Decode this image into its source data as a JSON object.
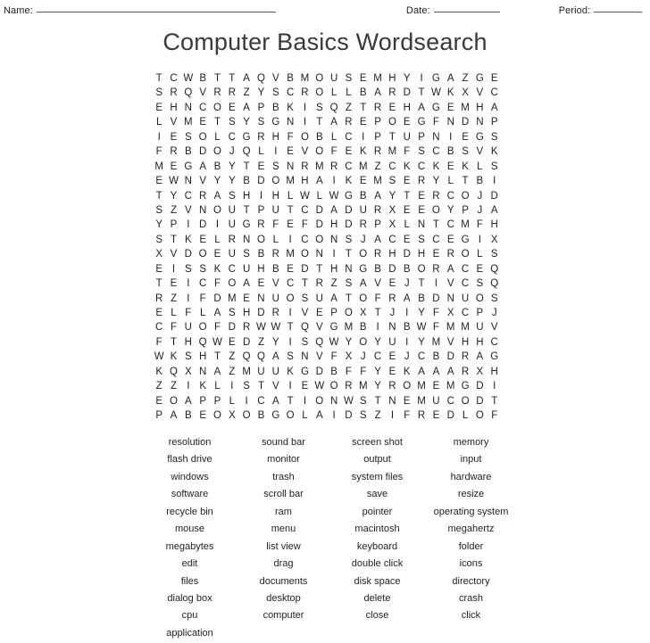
{
  "header": {
    "name_label": "Name:",
    "date_label": "Date:",
    "period_label": "Period:"
  },
  "title": "Computer Basics Wordsearch",
  "grid": {
    "rows": 24,
    "cols": 23,
    "letters": [
      [
        "T",
        "C",
        "W",
        "B",
        "T",
        "T",
        "A",
        "Q",
        "V",
        "B",
        "M",
        "O",
        "U",
        "S",
        "E",
        "M",
        "H",
        "Y",
        "I",
        "G",
        "A",
        "Z",
        "G",
        "E"
      ],
      [
        "S",
        "R",
        "Q",
        "V",
        "R",
        "R",
        "Z",
        "Y",
        "S",
        "C",
        "R",
        "O",
        "L",
        "L",
        "B",
        "A",
        "R",
        "D",
        "T",
        "W",
        "K",
        "X",
        "V",
        "C"
      ],
      [
        "E",
        "H",
        "N",
        "C",
        "O",
        "E",
        "A",
        "P",
        "B",
        "K",
        "I",
        "S",
        "Q",
        "Z",
        "T",
        "R",
        "E",
        "H",
        "A",
        "G",
        "E",
        "M",
        "H",
        "A"
      ],
      [
        "L",
        "V",
        "M",
        "E",
        "T",
        "S",
        "Y",
        "S",
        "G",
        "N",
        "I",
        "T",
        "A",
        "R",
        "E",
        "P",
        "O",
        "E",
        "G",
        "F",
        "N",
        "D",
        "N",
        "P"
      ],
      [
        "I",
        "E",
        "S",
        "O",
        "L",
        "C",
        "G",
        "R",
        "H",
        "F",
        "O",
        "B",
        "L",
        "C",
        "I",
        "P",
        "T",
        "U",
        "P",
        "N",
        "I",
        "E",
        "G",
        "S"
      ],
      [
        "F",
        "R",
        "B",
        "D",
        "O",
        "J",
        "Q",
        "L",
        "I",
        "E",
        "V",
        "O",
        "F",
        "E",
        "K",
        "R",
        "M",
        "F",
        "S",
        "C",
        "B",
        "S",
        "V",
        "K"
      ],
      [
        "M",
        "E",
        "G",
        "A",
        "B",
        "Y",
        "T",
        "E",
        "S",
        "N",
        "R",
        "M",
        "R",
        "C",
        "M",
        "Z",
        "C",
        "K",
        "C",
        "K",
        "E",
        "K",
        "L",
        "S"
      ],
      [
        "E",
        "W",
        "N",
        "V",
        "Y",
        "Y",
        "B",
        "D",
        "O",
        "M",
        "H",
        "A",
        "I",
        "K",
        "E",
        "M",
        "S",
        "E",
        "R",
        "Y",
        "L",
        "T",
        "B",
        "I"
      ],
      [
        "T",
        "Y",
        "C",
        "R",
        "A",
        "S",
        "H",
        "I",
        "H",
        "L",
        "W",
        "L",
        "W",
        "G",
        "B",
        "A",
        "Y",
        "T",
        "E",
        "R",
        "C",
        "O",
        "J",
        "D"
      ],
      [
        "S",
        "Z",
        "V",
        "N",
        "O",
        "U",
        "T",
        "P",
        "U",
        "T",
        "C",
        "D",
        "A",
        "D",
        "U",
        "R",
        "X",
        "E",
        "E",
        "O",
        "Y",
        "P",
        "J",
        "A"
      ],
      [
        "Y",
        "P",
        "I",
        "D",
        "I",
        "U",
        "G",
        "R",
        "F",
        "E",
        "F",
        "D",
        "H",
        "D",
        "R",
        "P",
        "X",
        "L",
        "N",
        "T",
        "C",
        "M",
        "F",
        "H"
      ],
      [
        "S",
        "T",
        "K",
        "E",
        "L",
        "R",
        "N",
        "O",
        "L",
        "I",
        "C",
        "O",
        "N",
        "S",
        "J",
        "A",
        "C",
        "E",
        "S",
        "C",
        "E",
        "G",
        "I",
        "X"
      ],
      [
        "X",
        "V",
        "D",
        "O",
        "E",
        "U",
        "S",
        "B",
        "R",
        "M",
        "O",
        "N",
        "I",
        "T",
        "O",
        "R",
        "H",
        "D",
        "H",
        "E",
        "R",
        "O",
        "L",
        "S"
      ],
      [
        "E",
        "I",
        "S",
        "S",
        "K",
        "C",
        "U",
        "H",
        "B",
        "E",
        "D",
        "T",
        "H",
        "N",
        "G",
        "B",
        "D",
        "B",
        "O",
        "R",
        "A",
        "C",
        "E",
        "Q"
      ],
      [
        "T",
        "E",
        "I",
        "C",
        "F",
        "O",
        "A",
        "E",
        "V",
        "C",
        "T",
        "R",
        "Z",
        "S",
        "A",
        "V",
        "E",
        "J",
        "T",
        "I",
        "V",
        "C",
        "S",
        "Q"
      ],
      [
        "R",
        "Z",
        "I",
        "F",
        "D",
        "M",
        "E",
        "N",
        "U",
        "O",
        "S",
        "U",
        "A",
        "T",
        "O",
        "F",
        "R",
        "A",
        "B",
        "D",
        "N",
        "U",
        "O",
        "S"
      ],
      [
        "E",
        "L",
        "F",
        "L",
        "A",
        "S",
        "H",
        "D",
        "R",
        "I",
        "V",
        "E",
        "P",
        "O",
        "X",
        "T",
        "J",
        "I",
        "Y",
        "F",
        "X",
        "C",
        "P",
        "J"
      ],
      [
        "C",
        "F",
        "U",
        "O",
        "F",
        "D",
        "R",
        "W",
        "W",
        "T",
        "Q",
        "V",
        "G",
        "M",
        "B",
        "I",
        "N",
        "B",
        "W",
        "F",
        "M",
        "M",
        "U",
        "V"
      ],
      [
        "F",
        "T",
        "H",
        "Q",
        "W",
        "E",
        "D",
        "Z",
        "Y",
        "I",
        "S",
        "Q",
        "W",
        "Y",
        "O",
        "Y",
        "U",
        "I",
        "Y",
        "M",
        "V",
        "H",
        "H",
        "C"
      ],
      [
        "W",
        "K",
        "S",
        "H",
        "T",
        "Z",
        "Q",
        "Q",
        "A",
        "S",
        "N",
        "V",
        "F",
        "X",
        "J",
        "C",
        "E",
        "J",
        "C",
        "B",
        "D",
        "R",
        "A",
        "G"
      ],
      [
        "K",
        "Q",
        "X",
        "N",
        "A",
        "Z",
        "M",
        "U",
        "U",
        "K",
        "G",
        "D",
        "B",
        "F",
        "F",
        "Y",
        "E",
        "K",
        "A",
        "A",
        "A",
        "R",
        "X",
        "H"
      ],
      [
        "Z",
        "Z",
        "I",
        "K",
        "L",
        "I",
        "S",
        "T",
        "V",
        "I",
        "E",
        "W",
        "O",
        "R",
        "M",
        "Y",
        "R",
        "O",
        "M",
        "E",
        "M",
        "G",
        "D",
        "I"
      ],
      [
        "E",
        "O",
        "A",
        "P",
        "P",
        "L",
        "I",
        "C",
        "A",
        "T",
        "I",
        "O",
        "N",
        "W",
        "S",
        "T",
        "N",
        "E",
        "M",
        "U",
        "C",
        "O",
        "D",
        "T"
      ],
      [
        "P",
        "A",
        "B",
        "E",
        "O",
        "X",
        "O",
        "B",
        "G",
        "O",
        "L",
        "A",
        "I",
        "D",
        "S",
        "Z",
        "I",
        "F",
        "R",
        "E",
        "D",
        "L",
        "O",
        "F"
      ]
    ]
  },
  "wordlist": {
    "rows": [
      [
        "resolution",
        "sound bar",
        "screen shot",
        "memory"
      ],
      [
        "flash drive",
        "monitor",
        "output",
        "input"
      ],
      [
        "windows",
        "trash",
        "system files",
        "hardware"
      ],
      [
        "software",
        "scroll bar",
        "save",
        "resize"
      ],
      [
        "recycle bin",
        "ram",
        "pointer",
        "operating system"
      ],
      [
        "mouse",
        "menu",
        "macintosh",
        "megahertz"
      ],
      [
        "megabytes",
        "list view",
        "keyboard",
        "folder"
      ],
      [
        "edit",
        "drag",
        "double click",
        "icons"
      ],
      [
        "files",
        "documents",
        "disk space",
        "directory"
      ],
      [
        "dialog box",
        "desktop",
        "delete",
        "crash"
      ],
      [
        "cpu",
        "computer",
        "close",
        "click"
      ],
      [
        "application",
        "",
        "",
        ""
      ]
    ]
  }
}
